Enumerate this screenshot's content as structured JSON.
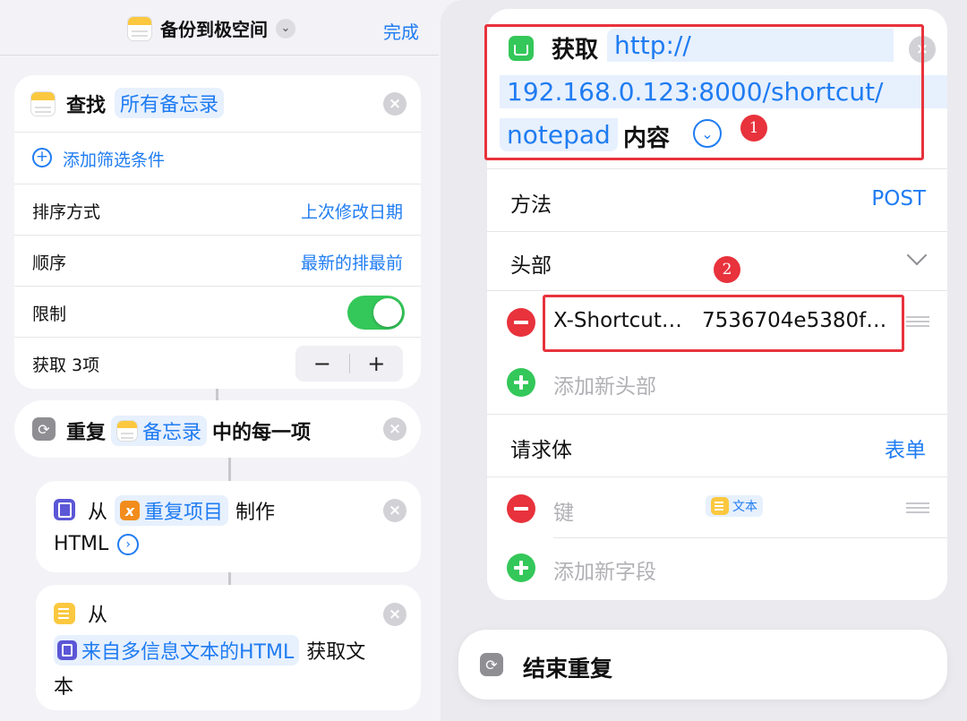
{
  "left": {
    "title": "备份到极空间",
    "done_label": "完成",
    "find": {
      "title": "查找",
      "target": "所有备忘录",
      "add_filter": "添加筛选条件",
      "sort_label": "排序方式",
      "sort_value": "上次修改日期",
      "order_label": "顺序",
      "order_value": "最新的排最前",
      "limit_label": "限制",
      "limit_on": true,
      "get_label": "获取 3项",
      "stepper_minus": "−",
      "stepper_plus": "+"
    },
    "repeat": {
      "title": "重复",
      "variable": "备忘录",
      "suffix": "中的每一项"
    },
    "make_html": {
      "from": "从",
      "variable": "重复项目",
      "action": "制作",
      "output": "HTML"
    },
    "get_text": {
      "from": "从",
      "variable": "来自多信息文本的HTML",
      "action": "获取文",
      "action_cont": "本"
    }
  },
  "right": {
    "get": {
      "label": "获取",
      "url_part1": "http://",
      "url_part2": "192.168.0.123:8000/shortcut/",
      "url_part3": "notepad",
      "content_label": "内容"
    },
    "method_label": "方法",
    "method_value": "POST",
    "headers_label": "头部",
    "header_key": "X-Shortcut…",
    "header_value": "7536704e5380f…",
    "add_header": "添加新头部",
    "body_label": "请求体",
    "body_value": "表单",
    "field_key_placeholder": "键",
    "field_type": "文本",
    "add_field": "添加新字段",
    "end_repeat": "结束重复"
  },
  "annotations": {
    "badge1": "1",
    "badge2": "2"
  },
  "colors": {
    "accent": "#1f7cf2",
    "toggle_on": "#34c759",
    "delete_red": "#e8323c",
    "annotation_red": "#e8323c"
  }
}
